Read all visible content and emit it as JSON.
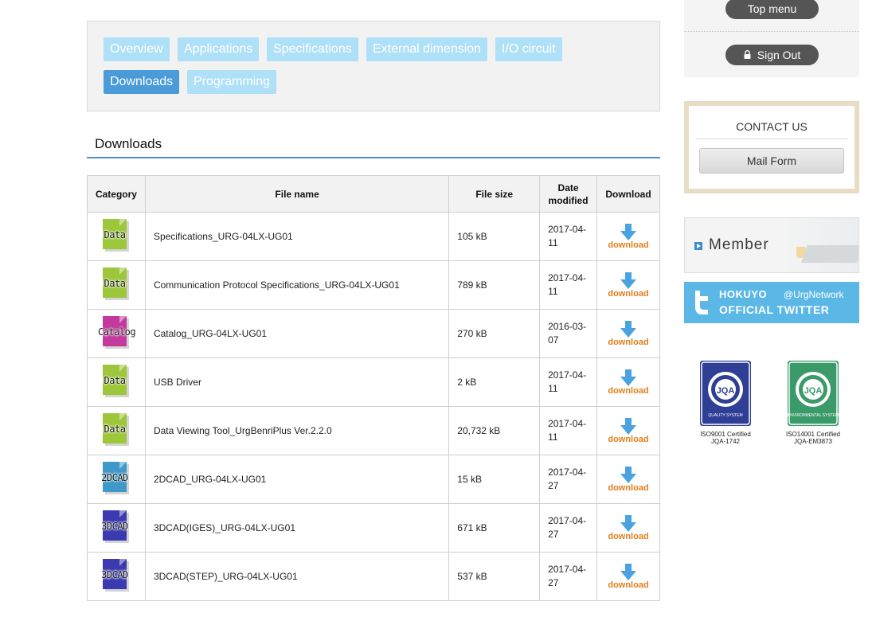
{
  "tabs": [
    {
      "label": "Overview",
      "active": false
    },
    {
      "label": "Applications",
      "active": false
    },
    {
      "label": "Specifications",
      "active": false
    },
    {
      "label": "External dimension",
      "active": false
    },
    {
      "label": "I/O circuit",
      "active": false
    },
    {
      "label": "Downloads",
      "active": true
    },
    {
      "label": "Programming",
      "active": false
    }
  ],
  "section": {
    "title": "Downloads"
  },
  "table": {
    "headers": {
      "category": "Category",
      "file_name": "File name",
      "file_size": "File size",
      "date_line1": "Date",
      "date_line2": "modified",
      "download": "Download"
    },
    "download_label": "download",
    "rows": [
      {
        "category": "Data",
        "color": "#9dc73a",
        "name": "Specifications_URG-04LX-UG01",
        "size": "105 kB",
        "date1": "2017-04-",
        "date2": "11"
      },
      {
        "category": "Data",
        "color": "#9dc73a",
        "name": "Communication Protocol Specifications_URG-04LX-UG01",
        "size": "789 kB",
        "date1": "2017-04-",
        "date2": "11"
      },
      {
        "category": "Catalog",
        "color": "#c23a9b",
        "name": "Catalog_URG-04LX-UG01",
        "size": "270 kB",
        "date1": "2016-03-",
        "date2": "07"
      },
      {
        "category": "Data",
        "color": "#9dc73a",
        "name": "USB Driver",
        "size": "2 kB",
        "date1": "2017-04-",
        "date2": "11"
      },
      {
        "category": "Data",
        "color": "#9dc73a",
        "name": "Data Viewing Tool_UrgBenriPlus Ver.2.2.0",
        "size": "20,732 kB",
        "date1": "2017-04-",
        "date2": "11"
      },
      {
        "category": "2DCAD",
        "color": "#3e98c9",
        "name": "2DCAD_URG-04LX-UG01",
        "size": "15 kB",
        "date1": "2017-04-",
        "date2": "27"
      },
      {
        "category": "3DCAD",
        "color": "#3b3ab0",
        "name": "3DCAD(IGES)_URG-04LX-UG01",
        "size": "671 kB",
        "date1": "2017-04-",
        "date2": "27"
      },
      {
        "category": "3DCAD",
        "color": "#3b3ab0",
        "name": "3DCAD(STEP)_URG-04LX-UG01",
        "size": "537 kB",
        "date1": "2017-04-",
        "date2": "27"
      }
    ]
  },
  "sidebar": {
    "top_menu": "Top menu",
    "sign_out": "Sign Out",
    "contact_title": "CONTACT US",
    "mail_form": "Mail Form",
    "member": "Member",
    "twitter_line1": "HOKUYO",
    "twitter_handle": "@UrgNetwork",
    "twitter_line2": "OFFICIAL TWITTER",
    "certs": [
      {
        "line1": "ISO9001 Certified",
        "line2": "JQA-1742",
        "color": "#2f3f95",
        "badge_text": "JQA",
        "badge_sub": "QUALITY SYSTEM"
      },
      {
        "line1": "ISO14001 Certified",
        "line2": "JQA-EM3873",
        "color": "#3b9a6a",
        "badge_text": "JQA",
        "badge_sub": "ENVIRONMENTAL SYSTEM"
      }
    ]
  },
  "colors": {
    "tab_inactive": "#aee0f7",
    "tab_active": "#4a9bd8",
    "rule": "#4a90cf",
    "download_orange": "#e07f1a",
    "download_arrow": "#4aa3e0",
    "twitter": "#5bb8e6"
  }
}
